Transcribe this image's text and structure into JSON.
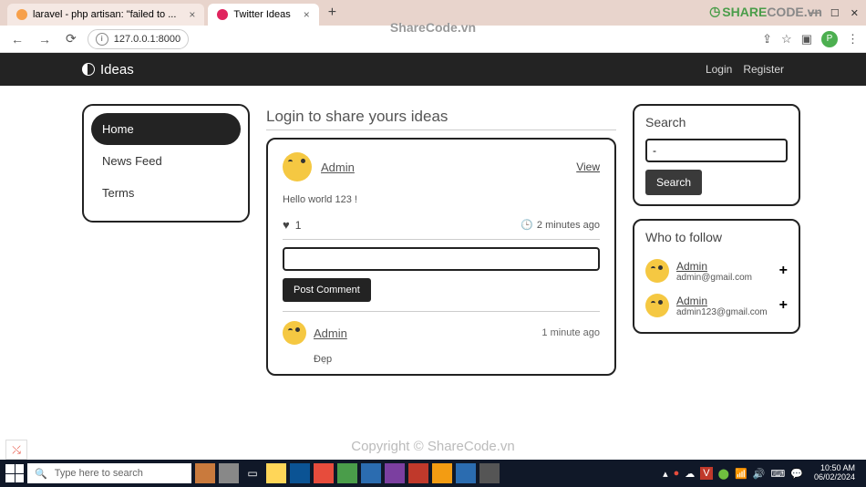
{
  "browser": {
    "tabs": [
      {
        "title": "laravel - php artisan: \"failed to ..."
      },
      {
        "title": "Twitter Ideas"
      }
    ],
    "url": "127.0.0.1:8000",
    "profile_initial": "P"
  },
  "navbar": {
    "brand": "Ideas",
    "links": {
      "login": "Login",
      "register": "Register"
    }
  },
  "sidebar": {
    "items": [
      {
        "label": "Home",
        "active": true
      },
      {
        "label": "News Feed",
        "active": false
      },
      {
        "label": "Terms",
        "active": false
      }
    ]
  },
  "main": {
    "title": "Login to share yours ideas",
    "post": {
      "author": "Admin",
      "view_label": "View",
      "content": "Hello world 123 !",
      "likes": "1",
      "timestamp": "2 minutes ago",
      "comment_input_value": "",
      "post_comment_label": "Post Comment",
      "comments": [
        {
          "author": "Admin",
          "timestamp": "1 minute ago",
          "body": "Đẹp"
        }
      ]
    }
  },
  "search": {
    "title": "Search",
    "value": "-",
    "button": "Search"
  },
  "follow": {
    "title": "Who to follow",
    "items": [
      {
        "name": "Admin",
        "email": "admin@gmail.com"
      },
      {
        "name": "Admin",
        "email": "admin123@gmail.com"
      }
    ]
  },
  "watermark": {
    "center": "ShareCode.vn",
    "logo_green": "SHARE",
    "logo_grey": "CODE.vn",
    "bottom": "Copyright © ShareCode.vn"
  },
  "taskbar": {
    "search_placeholder": "Type here to search",
    "time": "10:50 AM",
    "date": "06/02/2024"
  }
}
